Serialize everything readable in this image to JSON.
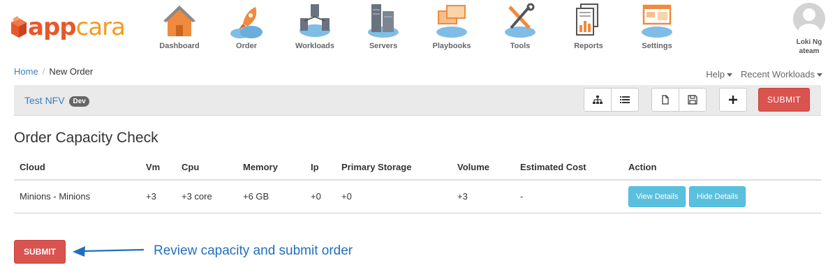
{
  "brand": {
    "part1": "app",
    "part2": "cara"
  },
  "nav": [
    {
      "label": "Dashboard",
      "icon": "dashboard-house-icon"
    },
    {
      "label": "Order",
      "icon": "order-rocket-icon"
    },
    {
      "label": "Workloads",
      "icon": "workloads-icon"
    },
    {
      "label": "Servers",
      "icon": "servers-icon"
    },
    {
      "label": "Playbooks",
      "icon": "playbooks-icon"
    },
    {
      "label": "Tools",
      "icon": "tools-icon"
    },
    {
      "label": "Reports",
      "icon": "reports-icon"
    },
    {
      "label": "Settings",
      "icon": "settings-icon"
    }
  ],
  "user": {
    "name": "Loki Ng",
    "team": "ateam"
  },
  "breadcrumb": {
    "home": "Home",
    "current": "New Order"
  },
  "header_links": {
    "help": "Help",
    "recent": "Recent Workloads"
  },
  "toolbar": {
    "title": "Test NFV",
    "badge": "Dev",
    "submit": "SUBMIT"
  },
  "section": {
    "title": "Order Capacity Check"
  },
  "table": {
    "columns": [
      "Cloud",
      "Vm",
      "Cpu",
      "Memory",
      "Ip",
      "Primary Storage",
      "Volume",
      "Estimated Cost",
      "Action"
    ],
    "rows": [
      {
        "cloud": "Minions - Minions",
        "vm": "+3",
        "cpu": "+3 core",
        "memory": "+6 GB",
        "ip": "+0",
        "primary_storage": "+0",
        "volume": "+3",
        "cost": "-",
        "view": "View Details",
        "hide": "Hide Details"
      }
    ]
  },
  "submit_button": "SUBMIT",
  "annotation": "Review capacity and submit order",
  "colors": {
    "brand_orange": "#e8572a",
    "danger": "#d9534f",
    "info": "#5bc0de",
    "link": "#3a7fc1",
    "annotation": "#1f6fc0"
  }
}
